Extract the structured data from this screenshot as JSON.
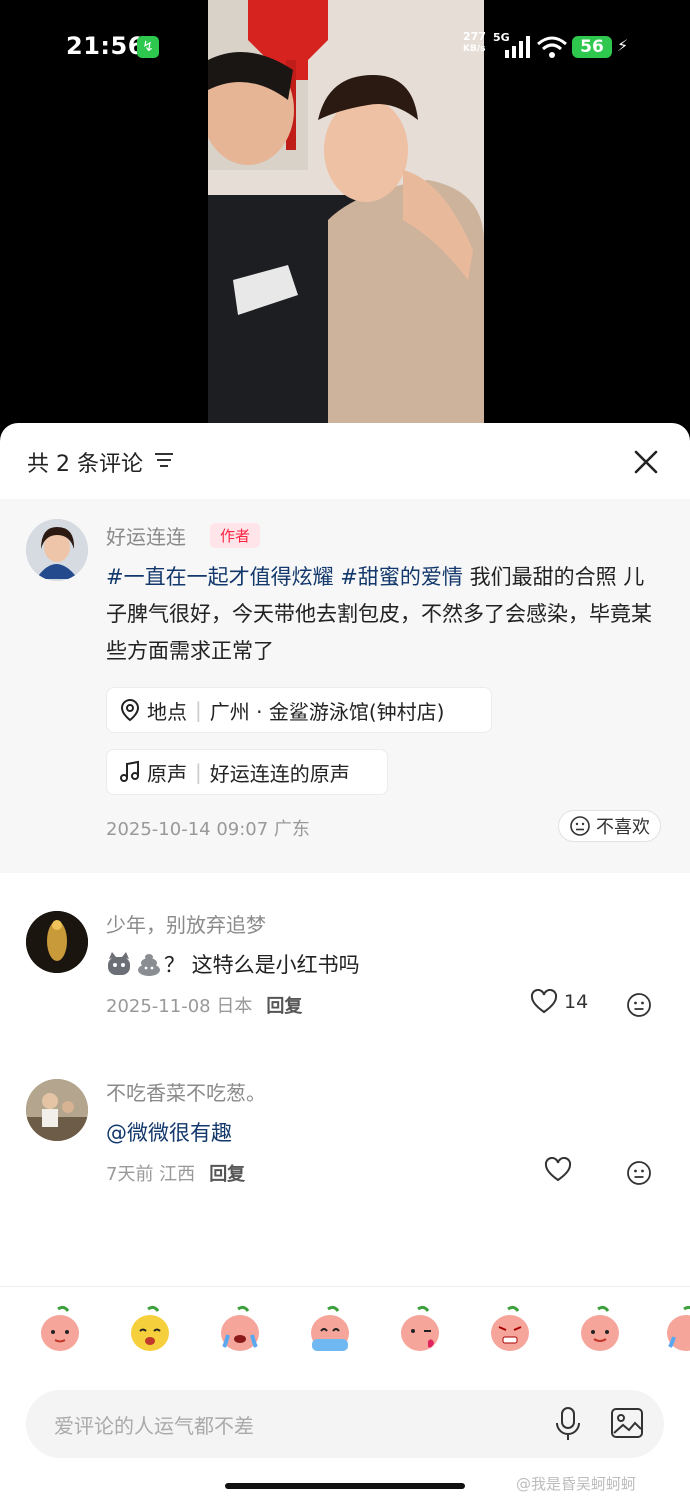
{
  "status_bar": {
    "time": "21:56",
    "net_speed_value": "277",
    "net_speed_unit": "KB/s",
    "network_type": "5G",
    "battery_level": "56",
    "accent_green": "#2dc84d"
  },
  "video": {
    "icons": [
      "charging-icon",
      "signal-icon",
      "wifi-icon",
      "battery-icon"
    ]
  },
  "comments_header": {
    "title": "共 2 条评论",
    "icons": [
      "filter-icon",
      "close-icon"
    ]
  },
  "author_comment": {
    "name": "好运连连",
    "tag": "作者",
    "hashtag1": "#一直在一起才值得炫耀",
    "hashtag2": "#甜蜜的爱情",
    "body": " 我们最甜的合照 儿子脾气很好，今天带他去割包皮，不然多了会感染，毕竟某些方面需求正常了",
    "location_label": "地点",
    "location_value": "广州 · 金鲨游泳馆(钟村店)",
    "sound_label": "原声",
    "sound_value": "好运连连的原声",
    "meta": "2025-10-14 09:07 广东",
    "dislike_label": "不喜欢"
  },
  "comments": [
    {
      "name": "少年，别放弃追梦",
      "text": "？ 这特么是小红书吗",
      "meta": "2025-11-08 日本",
      "reply": "回复",
      "likes": "14"
    },
    {
      "name": "不吃香菜不吃葱。",
      "text": "@微微很有趣",
      "meta": "7天前 江西",
      "reply": "回复",
      "likes": ""
    }
  ],
  "emoji_bar": {
    "icons": [
      "peach-shy-icon",
      "yellow-happy-icon",
      "peach-cry-icon",
      "peach-cover-eyes-icon",
      "peach-wink-icon",
      "peach-angry-icon",
      "peach-smile-icon",
      "peach-sad-icon"
    ]
  },
  "input": {
    "placeholder": "爱评论的人运气都不差",
    "icons": [
      "mic-icon",
      "image-icon"
    ]
  },
  "watermark": "@我是昏吴蚵蚵蚵"
}
